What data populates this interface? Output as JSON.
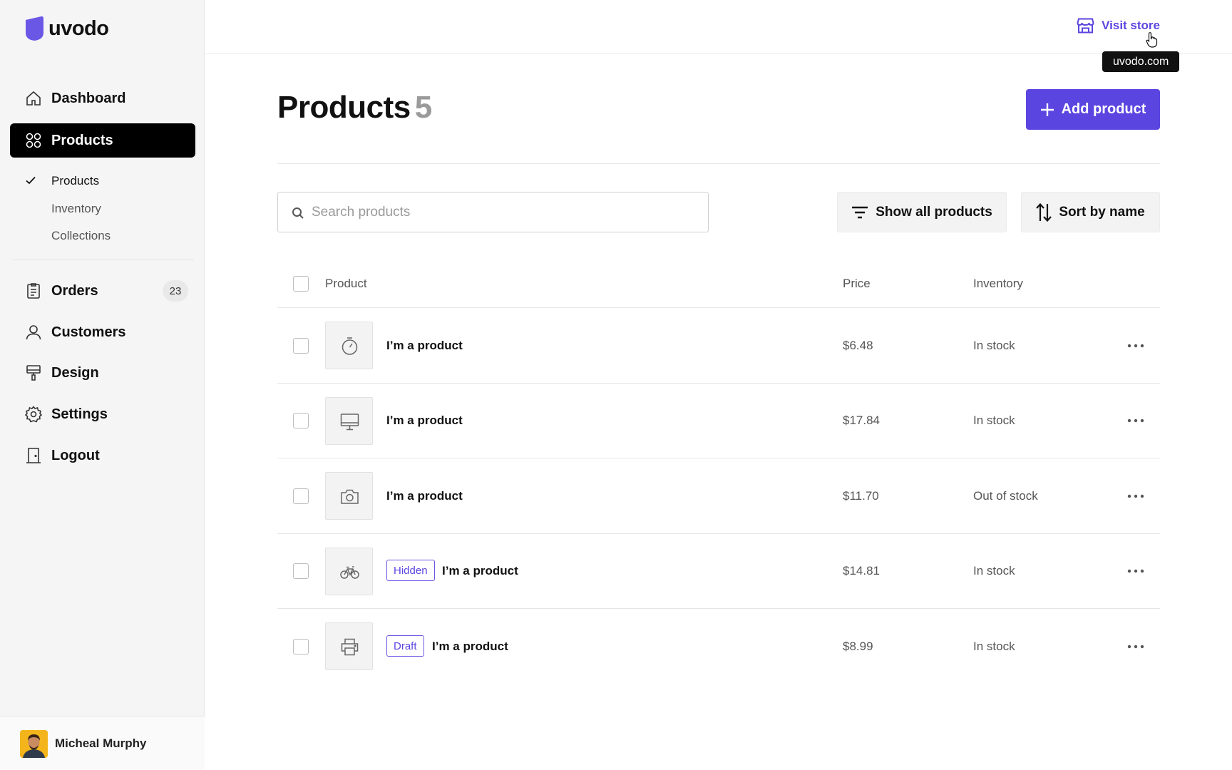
{
  "brand": {
    "name": "uvodo",
    "accent": "#5b45e0"
  },
  "sidebar": {
    "nav": [
      {
        "label": "Dashboard",
        "icon": "home-icon"
      },
      {
        "label": "Products",
        "icon": "grid-icon",
        "active": true
      },
      {
        "label": "Orders",
        "icon": "clipboard-icon",
        "badge": "23"
      },
      {
        "label": "Customers",
        "icon": "user-icon"
      },
      {
        "label": "Design",
        "icon": "paint-roller-icon"
      },
      {
        "label": "Settings",
        "icon": "gear-icon"
      },
      {
        "label": "Logout",
        "icon": "door-icon"
      }
    ],
    "sub": [
      {
        "label": "Products",
        "active": true
      },
      {
        "label": "Inventory"
      },
      {
        "label": "Collections"
      }
    ],
    "user": {
      "name": "Micheal Murphy"
    }
  },
  "topbar": {
    "visit_store": "Visit store",
    "tooltip": "uvodo.com"
  },
  "header": {
    "title": "Products",
    "count": "5",
    "add_button": "Add product"
  },
  "toolbar": {
    "search_placeholder": "Search products",
    "filter": "Show all products",
    "sort": "Sort by name"
  },
  "table": {
    "columns": {
      "product": "Product",
      "price": "Price",
      "inventory": "Inventory"
    },
    "rows": [
      {
        "icon": "stopwatch-icon",
        "tag": "",
        "name": "I’m a product",
        "price": "$6.48",
        "inventory": "In stock"
      },
      {
        "icon": "monitor-icon",
        "tag": "",
        "name": "I’m a product",
        "price": "$17.84",
        "inventory": "In stock"
      },
      {
        "icon": "camera-icon",
        "tag": "",
        "name": "I’m a product",
        "price": "$11.70",
        "inventory": "Out of stock"
      },
      {
        "icon": "bicycle-icon",
        "tag": "Hidden",
        "name": "I’m a product",
        "price": "$14.81",
        "inventory": "In stock"
      },
      {
        "icon": "printer-icon",
        "tag": "Draft",
        "name": "I’m a product",
        "price": "$8.99",
        "inventory": "In stock"
      }
    ]
  }
}
